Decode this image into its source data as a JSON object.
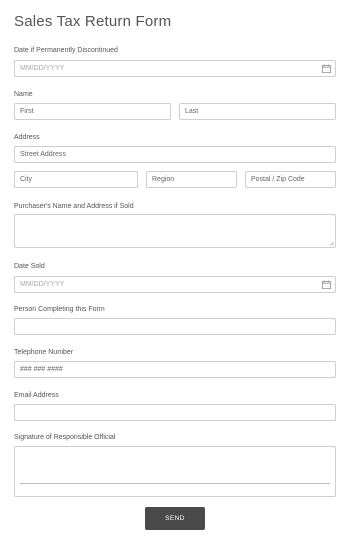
{
  "form": {
    "title": "Sales Tax Return Form",
    "discontinued": {
      "label": "Date if Permanently Discontinued",
      "placeholder": "MM/DD/YYYY",
      "icon": "calendar-icon"
    },
    "name": {
      "label": "Name",
      "first": "First",
      "last": "Last"
    },
    "address": {
      "label": "Address",
      "street": "Street Address",
      "city": "City",
      "region": "Region",
      "postal": "Postal / Zip Code"
    },
    "purchaser": {
      "label": "Purchaser's Name and Address if Sold"
    },
    "date_sold": {
      "label": "Date Sold",
      "placeholder": "MM/DD/YYYY",
      "icon": "calendar-icon"
    },
    "person": {
      "label": "Person Completing this Form"
    },
    "phone": {
      "label": "Telephone Number",
      "value": "### ### ####"
    },
    "email": {
      "label": "Email Address"
    },
    "signature": {
      "label": "Signature of Responsible Official"
    },
    "send_label": "SEND"
  },
  "colors": {
    "border": "#cfcfcf",
    "text": "#555555",
    "placeholder": "#a8a8a8",
    "button": "#4a4a4a",
    "button_text": "#ffffff"
  }
}
